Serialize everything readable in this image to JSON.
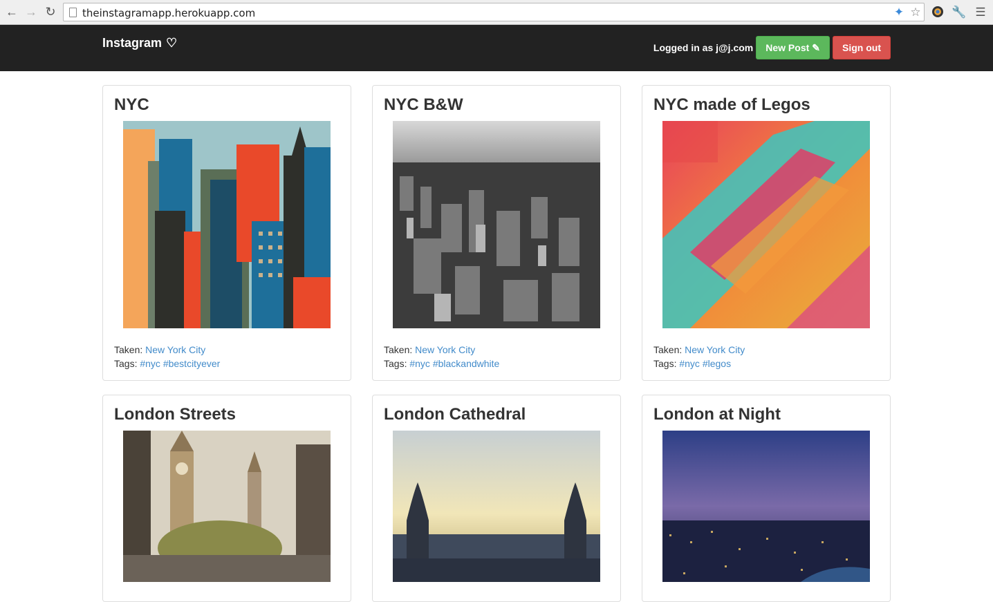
{
  "browser": {
    "url": "theinstagramapp.herokuapp.com"
  },
  "navbar": {
    "brand": "Instagram",
    "logged_in_text": "Logged in as j@j.com",
    "new_post_label": "New Post",
    "sign_out_label": "Sign out"
  },
  "labels": {
    "taken": "Taken:",
    "tags": "Tags:"
  },
  "posts": [
    {
      "title": "NYC",
      "location": "New York City",
      "tags": [
        "#nyc",
        "#bestcityever"
      ]
    },
    {
      "title": "NYC B&W",
      "location": "New York City",
      "tags": [
        "#nyc",
        "#blackandwhite"
      ]
    },
    {
      "title": "NYC made of Legos",
      "location": "New York City",
      "tags": [
        "#nyc",
        "#legos"
      ]
    },
    {
      "title": "London Streets"
    },
    {
      "title": "London Cathedral"
    },
    {
      "title": "London at Night"
    }
  ],
  "colors": {
    "navbar_bg": "#222222",
    "new_post_green": "#5cb85c",
    "sign_out_red": "#d9534f",
    "link_blue": "#428bca"
  }
}
